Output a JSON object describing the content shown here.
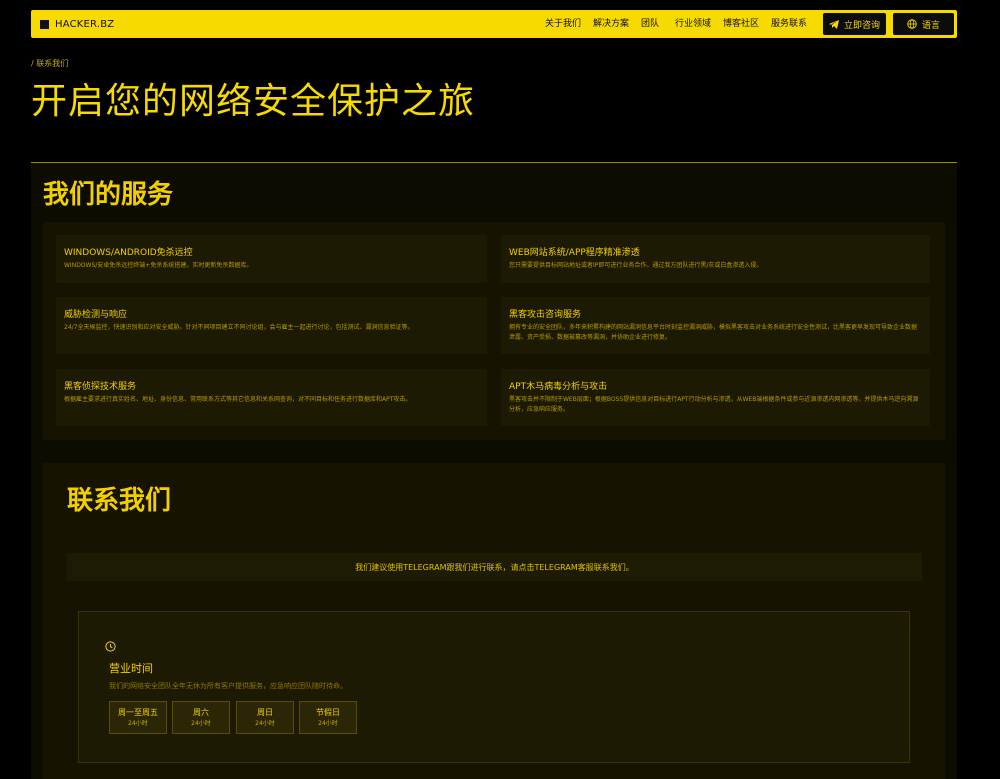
{
  "nav": {
    "brand": "HACKER.BZ",
    "links": [
      "关于我们",
      "解决方案",
      "团队",
      "行业领域",
      "博客社区",
      "服务联系"
    ],
    "consult_label": "立即咨询",
    "language_label": "语言"
  },
  "hero": {
    "breadcrumb": "/ 联系我们",
    "title": "开启您的网络安全保护之旅"
  },
  "services": {
    "title": "我们的服务",
    "items": [
      {
        "title": "WINDOWS/ANDROID免杀远控",
        "desc": "WINDOWS/安卓免杀远控终端+免杀系统搭建。实时更新免杀数据库。"
      },
      {
        "title": "WEB网站系统/APP程序精准渗透",
        "desc": "您只需要提供目标网站地址或者IP即可进行业务合作。通过我方团队进行黑/灰或白盒渗透入侵。"
      },
      {
        "title": "威胁检测与响应",
        "desc": "24/7全天候监控，快速识别和应对安全威胁。针对不同项目建立不同讨论组，会与雇主一起进行讨论，包括测试、漏洞信息验证等。"
      },
      {
        "title": "黑客攻击咨询服务",
        "desc": "拥有专业的安全团队，多年来积累构建的网站漏洞信息平台时刻监控漏洞威胁，模拟黑客攻击对业务系统进行安全性测试，比黑客更早发现可导致企业数据泄露、资产受损、数据被篡改等漏洞，并协助企业进行修复。"
      },
      {
        "title": "黑客侦探技术服务",
        "desc": "根据雇主要求进行真实姓名、地址、身份信息、常用联系方式等其它信息和关系网查询，对不同目标和任务进行数据库和APT攻击。"
      },
      {
        "title": "APT木马病毒分析与攻击",
        "desc": "黑客攻击并不限制于WEB层面；根据BOSS提供信息对目标进行APT行动分析与渗透，从WEB端根据条件或参与近源渗透内网渗透等。并提供木马逆向溯源分析，应急响应服务。"
      }
    ]
  },
  "contact": {
    "title": "联系我们",
    "notice": "我们建议使用TELEGRAM跟我们进行联系，请点击TELEGRAM客服联系我们。",
    "hours": {
      "icon": "clock-icon",
      "title": "营业时间",
      "desc": "我们的网络安全团队全年无休为所有客户提供服务，应急响应团队随时待命。",
      "slots": [
        {
          "day": "周一至周五",
          "time": "24小时"
        },
        {
          "day": "周六",
          "time": "24小时"
        },
        {
          "day": "周日",
          "time": "24小时"
        },
        {
          "day": "节假日",
          "time": "24小时"
        }
      ]
    }
  },
  "colors": {
    "accent": "#f7da00",
    "background": "#000000",
    "panel": "#161400"
  }
}
